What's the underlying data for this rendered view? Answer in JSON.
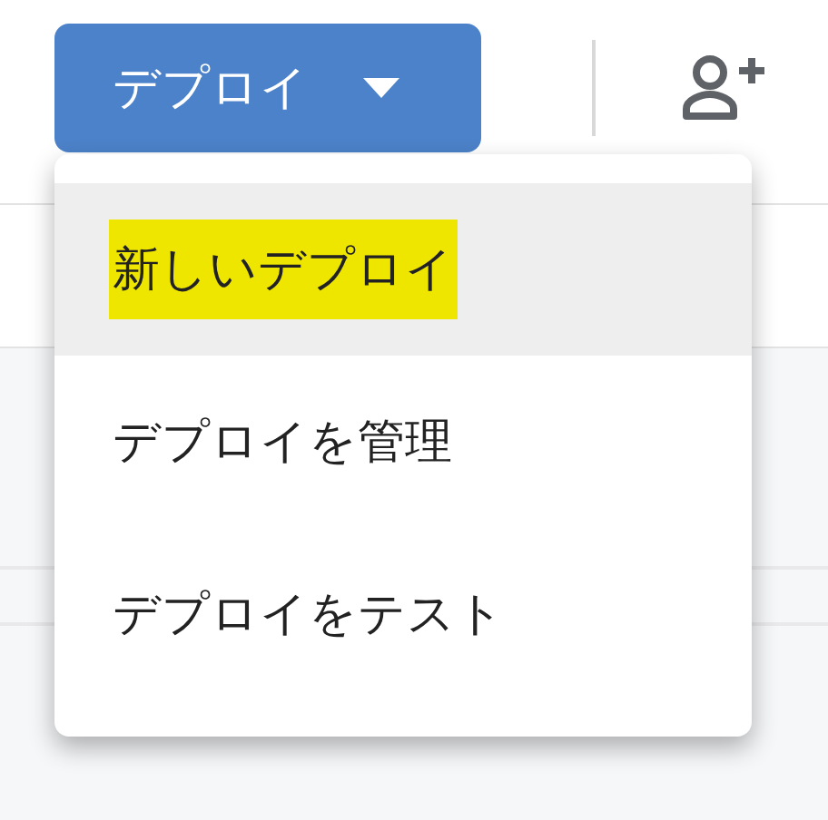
{
  "deploy_button": {
    "label": "デプロイ"
  },
  "menu": {
    "items": [
      {
        "label": "新しいデプロイ",
        "selected": true,
        "marked": true
      },
      {
        "label": "デプロイを管理",
        "selected": false,
        "marked": false
      },
      {
        "label": "デプロイをテスト",
        "selected": false,
        "marked": false
      }
    ]
  }
}
